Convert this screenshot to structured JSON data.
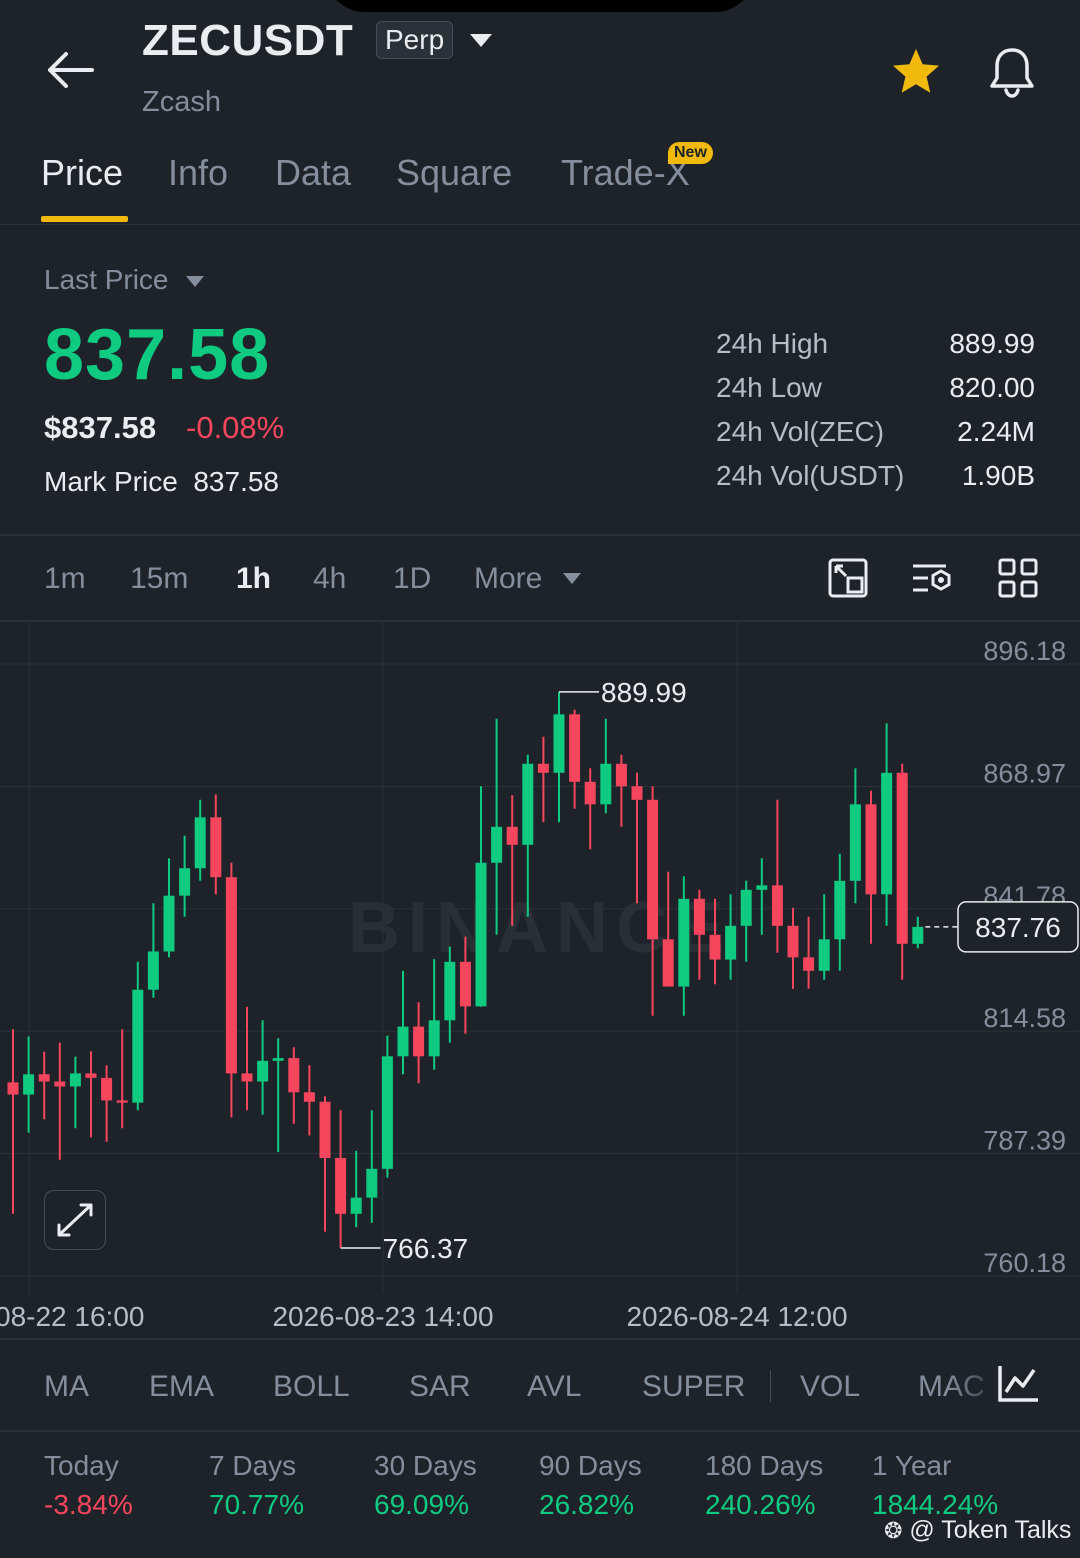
{
  "header": {
    "symbol": "ZECUSDT",
    "contract_type": "Perp",
    "subtitle": "Zcash",
    "star_color": "#f0b90b"
  },
  "tabs": [
    {
      "label": "Price",
      "active": true
    },
    {
      "label": "Info"
    },
    {
      "label": "Data"
    },
    {
      "label": "Square"
    },
    {
      "label": "Trade-X",
      "badge": "New"
    }
  ],
  "price": {
    "last_price_label": "Last Price",
    "last_price": "837.58",
    "usd_price": "$837.58",
    "change": "-0.08%",
    "mark_label": "Mark Price",
    "mark_price": "837.58",
    "up_color": "#0ecb81",
    "down_color": "#f6465d"
  },
  "stats": [
    {
      "label": "24h High",
      "value": "889.99"
    },
    {
      "label": "24h Low",
      "value": "820.00"
    },
    {
      "label": "24h Vol(ZEC)",
      "value": "2.24M"
    },
    {
      "label": "24h Vol(USDT)",
      "value": "1.90B"
    }
  ],
  "intervals": {
    "items": [
      "1m",
      "15m",
      "1h",
      "4h",
      "1D"
    ],
    "active": "1h",
    "more": "More"
  },
  "chart_data": {
    "type": "candlestick",
    "interval": "1h",
    "y_ticks": [
      "896.18",
      "868.97",
      "841.78",
      "814.58",
      "787.39",
      "760.18"
    ],
    "ylim": [
      760.18,
      896.18
    ],
    "x_ticks": [
      "08-22 16:00",
      "2026-08-23 14:00",
      "2026-08-24 12:00"
    ],
    "high_label": "889.99",
    "low_label": "766.37",
    "current_price_label": "837.76",
    "current_price": 837.76,
    "watermark": "BINANCE",
    "candles": [
      [
        803.2,
        800.5,
        815.0,
        774.0
      ],
      [
        800.5,
        805.0,
        813.4,
        792.0
      ],
      [
        805.0,
        803.4,
        810.0,
        795.0
      ],
      [
        803.4,
        802.3,
        812.0,
        786.0
      ],
      [
        802.3,
        805.2,
        808.9,
        793.0
      ],
      [
        805.2,
        804.2,
        810.1,
        791.0
      ],
      [
        804.2,
        799.2,
        807.0,
        790.0
      ],
      [
        799.2,
        798.7,
        815.0,
        793.0
      ],
      [
        798.7,
        823.8,
        830.0,
        797.0
      ],
      [
        823.8,
        832.3,
        843.0,
        822.0
      ],
      [
        832.3,
        844.7,
        853.0,
        831.0
      ],
      [
        844.7,
        850.8,
        858.0,
        840.0
      ],
      [
        850.8,
        862.1,
        866.0,
        848.0
      ],
      [
        862.1,
        848.8,
        867.2,
        845.0
      ],
      [
        848.8,
        805.2,
        852.0,
        795.4
      ],
      [
        805.2,
        803.4,
        820.0,
        797.0
      ],
      [
        803.4,
        808.0,
        817.0,
        796.0
      ],
      [
        808.0,
        808.6,
        813.0,
        787.7
      ],
      [
        808.6,
        801.0,
        811.0,
        794.0
      ],
      [
        801.0,
        798.9,
        807.0,
        791.4
      ],
      [
        798.9,
        786.4,
        800.1,
        770.0
      ],
      [
        786.4,
        774.0,
        797.0,
        766.4
      ],
      [
        774.0,
        777.6,
        788.0,
        771.0
      ],
      [
        777.6,
        784.0,
        797.0,
        772.0
      ],
      [
        784.0,
        809.0,
        813.6,
        782.0
      ],
      [
        809.0,
        815.6,
        828.0,
        805.0
      ],
      [
        815.6,
        809.0,
        821.0,
        803.0
      ],
      [
        809.0,
        817.0,
        830.6,
        806.0
      ],
      [
        817.0,
        830.0,
        833.4,
        812.0
      ],
      [
        830.0,
        820.1,
        835.6,
        814.0
      ],
      [
        820.1,
        852.0,
        869.0,
        820.0
      ],
      [
        852.0,
        860.0,
        884.0,
        836.0
      ],
      [
        860.0,
        856.0,
        867.0,
        838.0
      ],
      [
        856.0,
        874.0,
        876.0,
        840.0
      ],
      [
        874.0,
        872.0,
        880.0,
        861.0
      ],
      [
        872.0,
        885.0,
        889.99,
        861.0
      ],
      [
        885.0,
        870.0,
        886.0,
        864.0
      ],
      [
        870.0,
        865.0,
        873.0,
        855.0
      ],
      [
        865.0,
        874.0,
        884.0,
        863.0
      ],
      [
        874.0,
        869.0,
        876.0,
        860.0
      ],
      [
        869.0,
        866.0,
        872.0,
        843.0
      ],
      [
        866.0,
        835.0,
        869.0,
        818.0
      ],
      [
        835.0,
        824.5,
        850.0,
        826.0
      ],
      [
        824.5,
        844.0,
        849.0,
        818.0
      ],
      [
        844.0,
        836.0,
        846.0,
        826.0
      ],
      [
        836.0,
        830.5,
        844.0,
        825.0
      ],
      [
        830.5,
        838.0,
        845.0,
        826.0
      ],
      [
        838.0,
        846.0,
        848.0,
        830.0
      ],
      [
        846.0,
        847.0,
        853.0,
        836.0
      ],
      [
        847.0,
        838.0,
        866.0,
        832.0
      ],
      [
        838.0,
        831.0,
        842.0,
        824.0
      ],
      [
        831.0,
        828.0,
        840.0,
        824.0
      ],
      [
        828.0,
        835.0,
        845.0,
        826.0
      ],
      [
        835.0,
        848.0,
        854.0,
        828.0
      ],
      [
        848.0,
        865.0,
        873.0,
        843.0
      ],
      [
        865.0,
        845.0,
        868.0,
        834.0
      ],
      [
        845.0,
        872.0,
        883.0,
        838.0
      ],
      [
        872.0,
        834.0,
        874.0,
        826.0
      ],
      [
        834.0,
        837.76,
        840.0,
        833.0
      ]
    ]
  },
  "indicators": [
    "MA",
    "EMA",
    "BOLL",
    "SAR",
    "AVL",
    "SUPER",
    "VOL",
    "MAC"
  ],
  "performance": [
    {
      "label": "Today",
      "value": "-3.84%",
      "dir": "neg"
    },
    {
      "label": "7 Days",
      "value": "70.77%",
      "dir": "pos"
    },
    {
      "label": "30 Days",
      "value": "69.09%",
      "dir": "pos"
    },
    {
      "label": "90 Days",
      "value": "26.82%",
      "dir": "pos"
    },
    {
      "label": "180 Days",
      "value": "240.26%",
      "dir": "pos"
    },
    {
      "label": "1 Year",
      "value": "1844.24%",
      "dir": "pos"
    }
  ],
  "watermark_text": "@ Token Talks"
}
